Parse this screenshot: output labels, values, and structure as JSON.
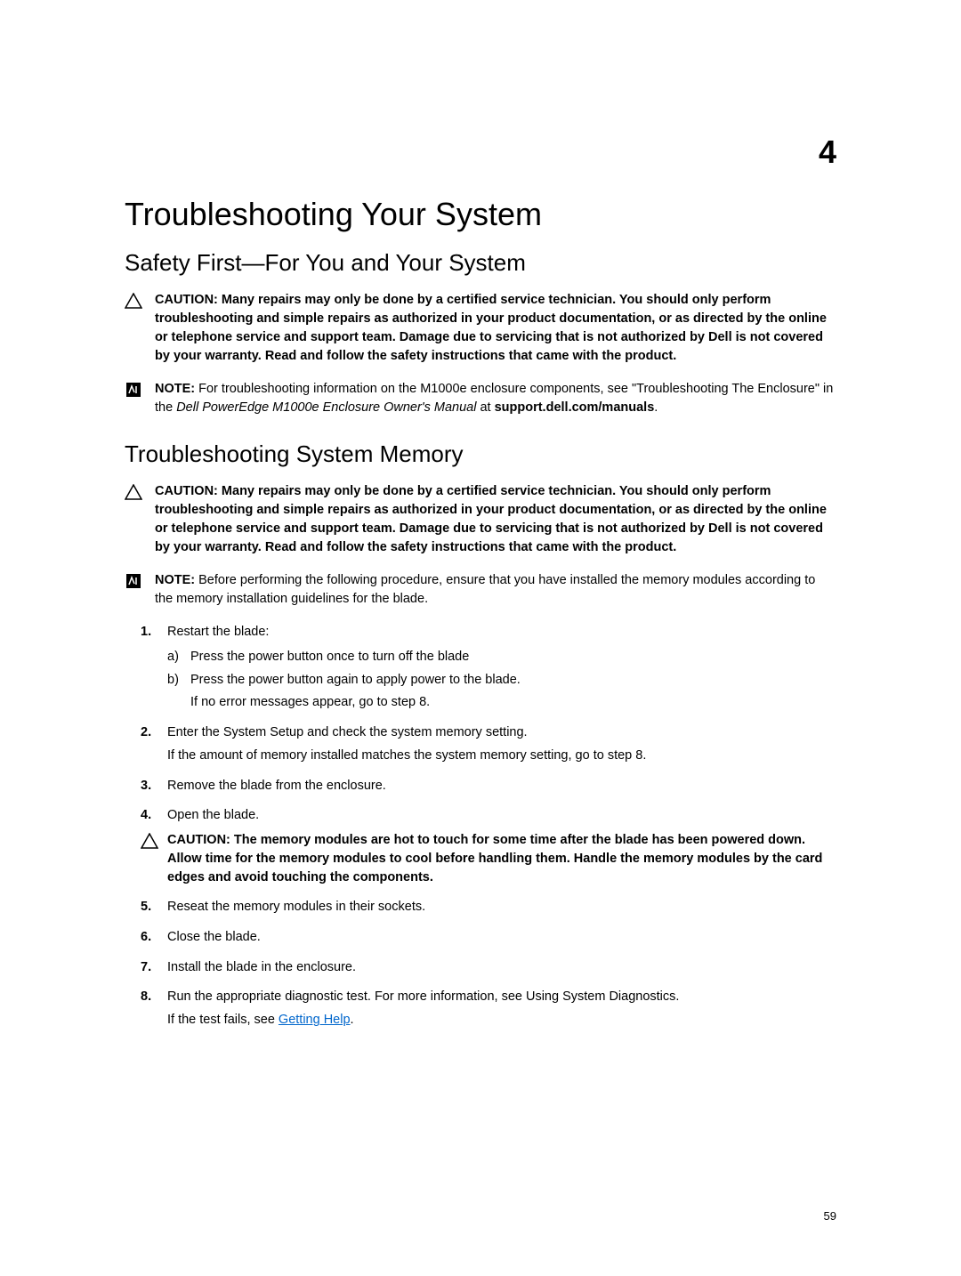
{
  "chapter": "4",
  "title": "Troubleshooting Your System",
  "section1": {
    "heading": "Safety First—For You and Your System",
    "caution_label": "CAUTION: ",
    "caution_text": "Many repairs may only be done by a certified service technician. You should only perform troubleshooting and simple repairs as authorized in your product documentation, or as directed by the online or telephone service and support team. Damage due to servicing that is not authorized by Dell is not covered by your warranty. Read and follow the safety instructions that came with the product.",
    "note_label": "NOTE: ",
    "note_pre": "For troubleshooting information on the M1000e enclosure components, see \"Troubleshooting The Enclosure\" in the ",
    "note_italic": "Dell PowerEdge M1000e Enclosure Owner's Manual",
    "note_mid": " at ",
    "note_bold": "support.dell.com/manuals",
    "note_post": "."
  },
  "section2": {
    "heading": "Troubleshooting System Memory",
    "caution_label": "CAUTION: ",
    "caution_text": "Many repairs may only be done by a certified service technician. You should only perform troubleshooting and simple repairs as authorized in your product documentation, or as directed by the online or telephone service and support team. Damage due to servicing that is not authorized by Dell is not covered by your warranty. Read and follow the safety instructions that came with the product.",
    "note_label": "NOTE: ",
    "note_text": "Before performing the following procedure, ensure that you have installed the memory modules according to the memory installation guidelines for the blade.",
    "steps": {
      "s1": "Restart the blade:",
      "s1a": "Press the power button once to turn off the blade",
      "s1b": "Press the power button again to apply power to the blade.",
      "s1after": "If no error messages appear, go to step 8.",
      "s2": "Enter the System Setup and check the system memory setting.",
      "s2after": "If the amount of memory installed matches the system memory setting, go to step 8.",
      "s3": "Remove the blade from the enclosure.",
      "s4": "Open the blade.",
      "s4caution_label": "CAUTION: ",
      "s4caution_text": "The memory modules are hot to touch for some time after the blade has been powered down. Allow time for the memory modules to cool before handling them. Handle the memory modules by the card edges and avoid touching the components.",
      "s5": "Reseat the memory modules in their sockets.",
      "s6": "Close the blade.",
      "s7": "Install the blade in the enclosure.",
      "s8": "Run the appropriate diagnostic test. For more information, see Using System Diagnostics.",
      "s8after_pre": "If the test fails, see ",
      "s8after_link": "Getting Help",
      "s8after_post": "."
    }
  },
  "page_number": "59"
}
